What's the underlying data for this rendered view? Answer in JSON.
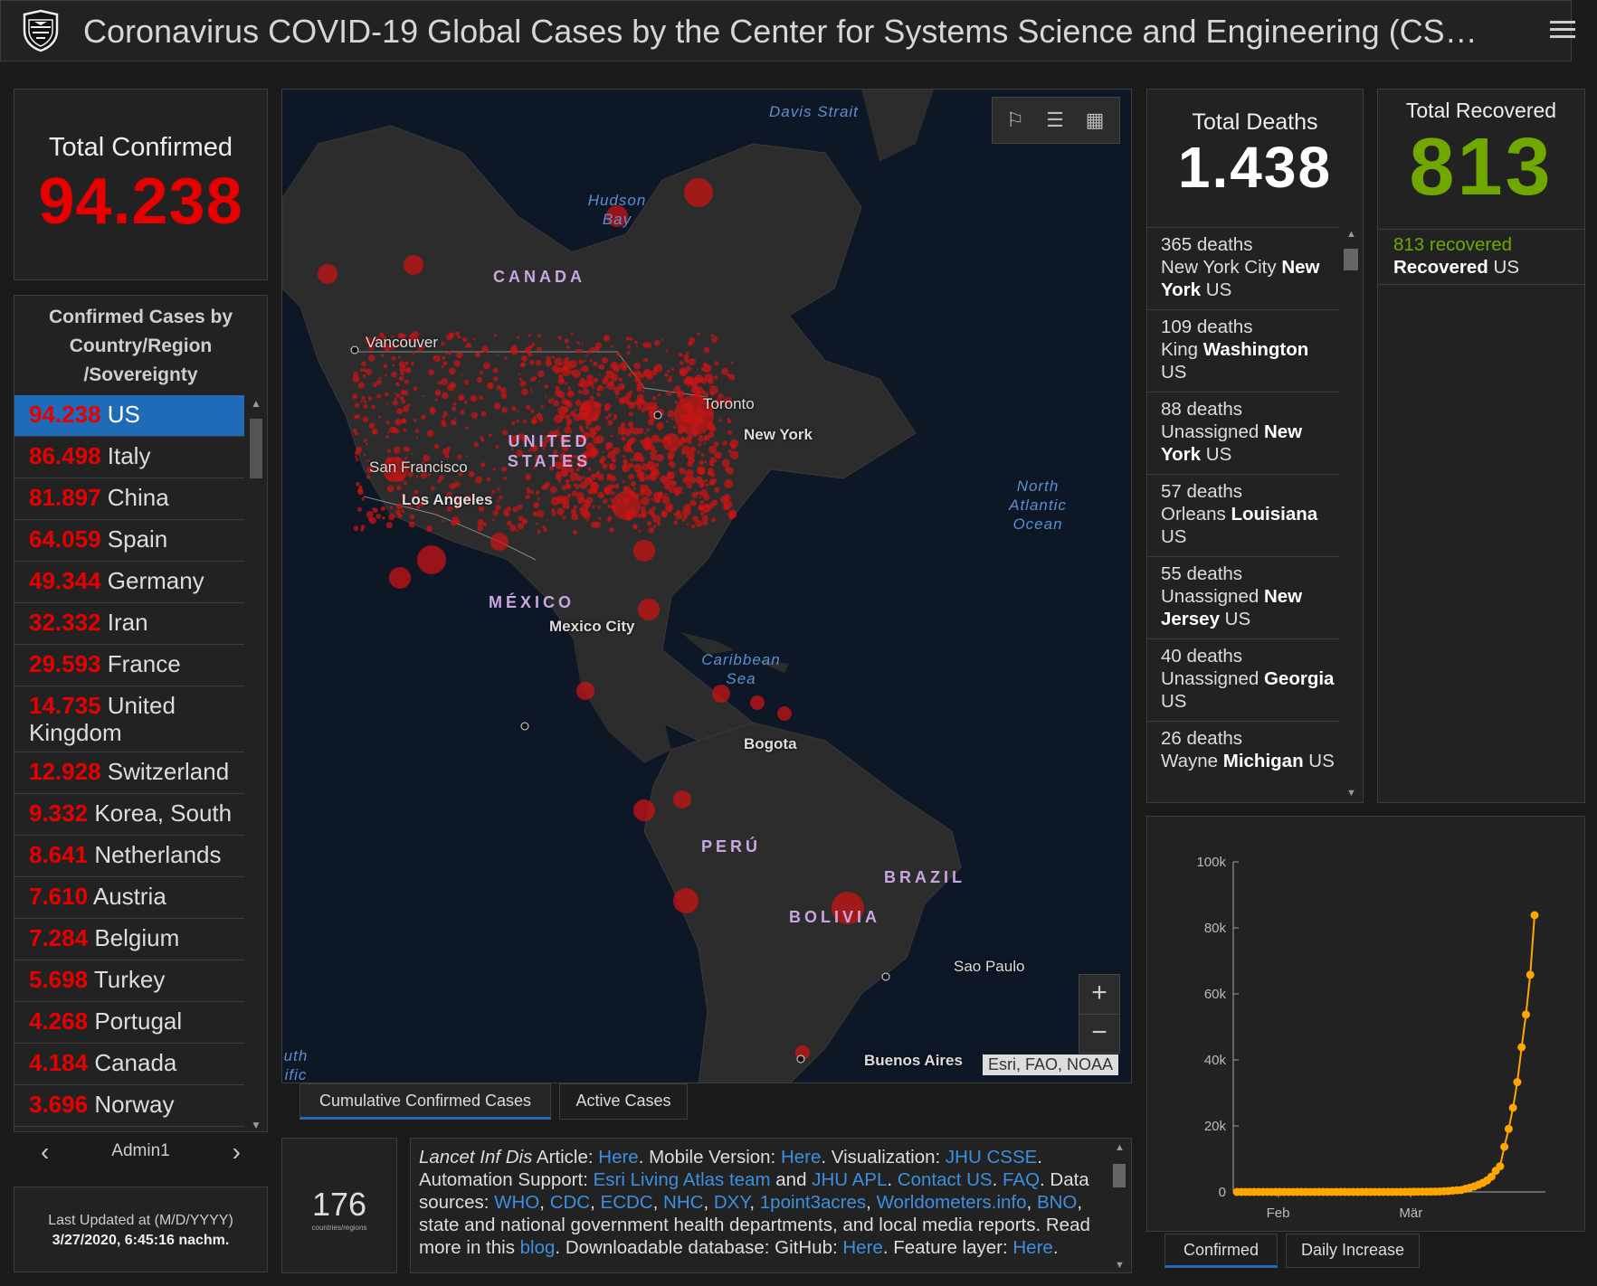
{
  "header": {
    "title": "Coronavirus COVID-19 Global Cases by the Center for Systems Science and Engineering (CS…"
  },
  "total_confirmed": {
    "label": "Total Confirmed",
    "value": "94.238"
  },
  "country_list": {
    "header": [
      "Confirmed Cases by",
      "Country/Region",
      "/Sovereignty"
    ],
    "items": [
      {
        "count": "94.238",
        "name": "US"
      },
      {
        "count": "86.498",
        "name": "Italy"
      },
      {
        "count": "81.897",
        "name": "China"
      },
      {
        "count": "64.059",
        "name": "Spain"
      },
      {
        "count": "49.344",
        "name": "Germany"
      },
      {
        "count": "32.332",
        "name": "Iran"
      },
      {
        "count": "29.593",
        "name": "France"
      },
      {
        "count": "14.735",
        "name": "United Kingdom"
      },
      {
        "count": "12.928",
        "name": "Switzerland"
      },
      {
        "count": "9.332",
        "name": "Korea, South"
      },
      {
        "count": "8.641",
        "name": "Netherlands"
      },
      {
        "count": "7.610",
        "name": "Austria"
      },
      {
        "count": "7.284",
        "name": "Belgium"
      },
      {
        "count": "5.698",
        "name": "Turkey"
      },
      {
        "count": "4.268",
        "name": "Portugal"
      },
      {
        "count": "4.184",
        "name": "Canada"
      },
      {
        "count": "3.696",
        "name": "Norway"
      }
    ],
    "pager_label": "Admin1"
  },
  "last_updated": {
    "label": "Last Updated at (M/D/YYYY)",
    "value": "3/27/2020, 6:45:16 nachm."
  },
  "map": {
    "labels": {
      "davis": "Davis Strait",
      "hudson": "Hudson Bay",
      "north_atlantic": "North Atlantic Ocean",
      "caribbean": "Caribbean Sea",
      "pacific": "uth ific",
      "canada": "CANADA",
      "us": "UNITED STATES",
      "mexico": "MÉXICO",
      "peru": "PERÚ",
      "brazil": "BRAZIL",
      "bolivia": "BOLIVIA",
      "vancouver": "Vancouver",
      "toronto": "Toronto",
      "new_york": "New York",
      "san_francisco": "San Francisco",
      "los_angeles": "Los Angeles",
      "mexico_city": "Mexico City",
      "bogota": "Bogota",
      "sao_paulo": "Sao Paulo",
      "buenos_aires": "Buenos Aires"
    },
    "attribution": "Esri, FAO, NOAA",
    "zoom_in": "+",
    "zoom_out": "−",
    "tools": [
      "bookmark-icon",
      "list-icon",
      "grid-icon"
    ]
  },
  "map_tabs": [
    "Cumulative Confirmed Cases",
    "Active Cases"
  ],
  "countries_count": {
    "value": "176",
    "label": "countries/regions"
  },
  "info": {
    "parts": [
      {
        "t": "Lancet Inf Dis",
        "i": true
      },
      {
        "t": " Article: "
      },
      {
        "t": "Here",
        "l": true
      },
      {
        "t": ". Mobile Version: "
      },
      {
        "t": "Here",
        "l": true
      },
      {
        "t": ". Visualization: "
      },
      {
        "t": "JHU CSSE",
        "l": true
      },
      {
        "t": ". Automation Support: "
      },
      {
        "t": "Esri Living Atlas team",
        "l": true
      },
      {
        "t": " and "
      },
      {
        "t": "JHU APL",
        "l": true
      },
      {
        "t": ". "
      },
      {
        "t": "Contact US",
        "l": true
      },
      {
        "t": ". "
      },
      {
        "t": "FAQ",
        "l": true
      },
      {
        "t": ". Data sources: "
      },
      {
        "t": "WHO",
        "l": true
      },
      {
        "t": ", "
      },
      {
        "t": "CDC",
        "l": true
      },
      {
        "t": ", "
      },
      {
        "t": "ECDC",
        "l": true
      },
      {
        "t": ", "
      },
      {
        "t": "NHC",
        "l": true
      },
      {
        "t": ", "
      },
      {
        "t": "DXY",
        "l": true
      },
      {
        "t": ", "
      },
      {
        "t": "1point3acres",
        "l": true
      },
      {
        "t": ", "
      },
      {
        "t": "Worldometers.info",
        "l": true
      },
      {
        "t": ", "
      },
      {
        "t": "BNO",
        "l": true
      },
      {
        "t": ", state and national government health departments, and local media reports.  Read more in this "
      },
      {
        "t": "blog",
        "l": true
      },
      {
        "t": ". Downloadable database: GitHub: "
      },
      {
        "t": "Here",
        "l": true
      },
      {
        "t": ". Feature layer: "
      },
      {
        "t": "Here",
        "l": true
      },
      {
        "t": "."
      }
    ]
  },
  "total_deaths": {
    "label": "Total Deaths",
    "value": "1.438",
    "items": [
      {
        "count": "365 deaths",
        "pre": "New York City ",
        "bold": "New York",
        "post": " US"
      },
      {
        "count": "109 deaths",
        "pre": "King ",
        "bold": "Washington",
        "post": " US"
      },
      {
        "count": "88 deaths",
        "pre": "Unassigned ",
        "bold": "New York",
        "post": " US"
      },
      {
        "count": "57 deaths",
        "pre": "Orleans ",
        "bold": "Louisiana",
        "post": " US"
      },
      {
        "count": "55 deaths",
        "pre": "Unassigned ",
        "bold": "New Jersey",
        "post": " US"
      },
      {
        "count": "40 deaths",
        "pre": "Unassigned ",
        "bold": "Georgia",
        "post": " US"
      },
      {
        "count": "26 deaths",
        "pre": "Wayne ",
        "bold": "Michigan",
        "post": " US"
      }
    ]
  },
  "total_recovered": {
    "label": "Total Recovered",
    "value": "813",
    "item": {
      "count": "813 recovered",
      "bold": "Recovered",
      "post": " US"
    }
  },
  "chart_data": {
    "type": "line",
    "y_ticks": [
      "100k",
      "80k",
      "60k",
      "40k",
      "20k",
      "0"
    ],
    "x_ticks": [
      "Feb",
      "Mär"
    ],
    "ylim": [
      0,
      100000
    ],
    "color": "#ffa500",
    "x_days": [
      0,
      1,
      2,
      3,
      4,
      5,
      6,
      7,
      8,
      9,
      10,
      11,
      12,
      13,
      14,
      15,
      16,
      17,
      18,
      19,
      20,
      21,
      22,
      23,
      24,
      25,
      26,
      27,
      28,
      29,
      30,
      31,
      32,
      33,
      34,
      35,
      36,
      37,
      38,
      39,
      40,
      41,
      42,
      43,
      44,
      45,
      46,
      47,
      48,
      49,
      50,
      51,
      52,
      53,
      54,
      55,
      56,
      57,
      58,
      59,
      60,
      61,
      62,
      63,
      64,
      65
    ],
    "values": [
      1,
      1,
      2,
      2,
      5,
      5,
      5,
      5,
      5,
      6,
      8,
      8,
      11,
      11,
      11,
      12,
      12,
      12,
      13,
      13,
      14,
      14,
      15,
      15,
      15,
      15,
      15,
      15,
      15,
      15,
      15,
      15,
      15,
      15,
      15,
      15,
      15,
      16,
      16,
      24,
      30,
      53,
      62,
      70,
      74,
      98,
      118,
      149,
      217,
      262,
      402,
      518,
      583,
      959,
      1281,
      1663,
      2179,
      2727,
      3499,
      4632,
      6421,
      7786,
      13680,
      19101,
      25493,
      33276,
      43847,
      53740,
      65778,
      83836
    ]
  },
  "chart_tabs": [
    "Confirmed",
    "Daily Increase"
  ]
}
